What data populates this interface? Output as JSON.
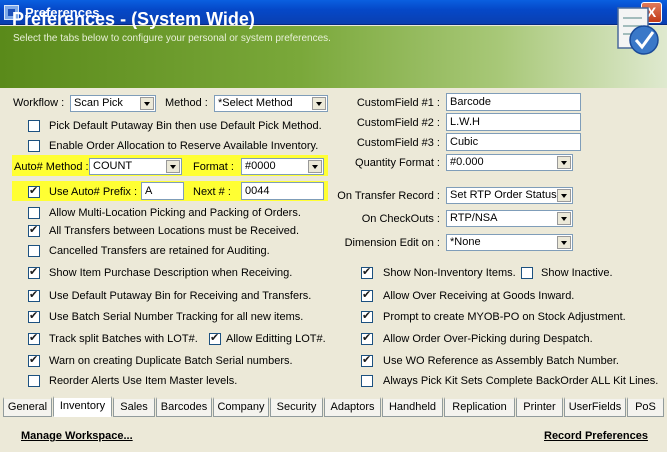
{
  "window": {
    "title": "Preferences",
    "close_label": "X"
  },
  "header": {
    "title": "Preferences - (System Wide)",
    "subtitle": "Select the tabs below to configure your personal or system preferences."
  },
  "left": {
    "workflow_label": "Workflow :",
    "workflow_value": "Scan Pick",
    "method_label": "Method :",
    "method_value": "*Select Method",
    "items": [
      {
        "label": "Pick Default Putaway Bin then use Default Pick Method.",
        "checked": false
      },
      {
        "label": "Enable Order Allocation to Reserve Available Inventory.",
        "checked": false
      }
    ],
    "auto_method_label": "Auto# Method :",
    "auto_method_value": "COUNT",
    "format_label": "Format :",
    "format_value": "#0000",
    "use_prefix_label": "Use Auto# Prefix :",
    "use_prefix_checked": true,
    "prefix_value": "A",
    "next_label": "Next # :",
    "next_value": "0044",
    "items2": [
      {
        "label": "Allow Multi-Location Picking and Packing of Orders.",
        "checked": false
      },
      {
        "label": "All Transfers between Locations must be Received.",
        "checked": true
      },
      {
        "label": "Cancelled Transfers are retained for Auditing.",
        "checked": false
      },
      {
        "label": "Show Item Purchase Description when Receiving.",
        "checked": true
      },
      {
        "label": "Use Default Putaway Bin for Receiving and Transfers.",
        "checked": true
      },
      {
        "label": "Use Batch Serial Number Tracking for all new items.",
        "checked": true
      }
    ],
    "track_split_label": "Track split Batches with LOT#.",
    "track_split_checked": true,
    "allow_edit_lot_label": "Allow Editting LOT#.",
    "allow_edit_lot_checked": true,
    "items3": [
      {
        "label": "Warn on creating Duplicate Batch Serial numbers.",
        "checked": true
      },
      {
        "label": "Reorder Alerts Use Item Master levels.",
        "checked": false
      }
    ]
  },
  "right": {
    "custom_fields": [
      {
        "label": "CustomField #1 :",
        "value": "Barcode"
      },
      {
        "label": "CustomField #2 :",
        "value": "L.W.H"
      },
      {
        "label": "CustomField #3 :",
        "value": "Cubic"
      }
    ],
    "quantity_format_label": "Quantity Format :",
    "quantity_format_value": "#0.000",
    "on_transfer_label": "On Transfer Record :",
    "on_transfer_value": "Set RTP Order Status",
    "on_checkouts_label": "On CheckOuts :",
    "on_checkouts_value": "RTP/NSA",
    "dimension_label": "Dimension Edit on :",
    "dimension_value": "*None",
    "show_noninv_label": "Show Non-Inventory Items.",
    "show_noninv_checked": true,
    "show_inactive_label": "Show Inactive.",
    "show_inactive_checked": false,
    "items": [
      {
        "label": "Allow Over Receiving at Goods Inward.",
        "checked": true
      },
      {
        "label": "Prompt to create MYOB-PO on Stock Adjustment.",
        "checked": true
      },
      {
        "label": "Allow Order Over-Picking during Despatch.",
        "checked": true
      },
      {
        "label": "Use WO Reference as Assembly Batch Number.",
        "checked": true
      },
      {
        "label": "Always Pick Kit Sets Complete BackOrder ALL Kit Lines.",
        "checked": false
      }
    ]
  },
  "tabs": [
    "General",
    "Inventory",
    "Sales",
    "Barcodes",
    "Company",
    "Security",
    "Adaptors",
    "Handheld",
    "Replication",
    "Printer",
    "UserFields",
    "PoS"
  ],
  "active_tab": "Inventory",
  "footer": {
    "manage_workspace": "Manage Workspace...",
    "record_preferences": "Record Preferences"
  }
}
